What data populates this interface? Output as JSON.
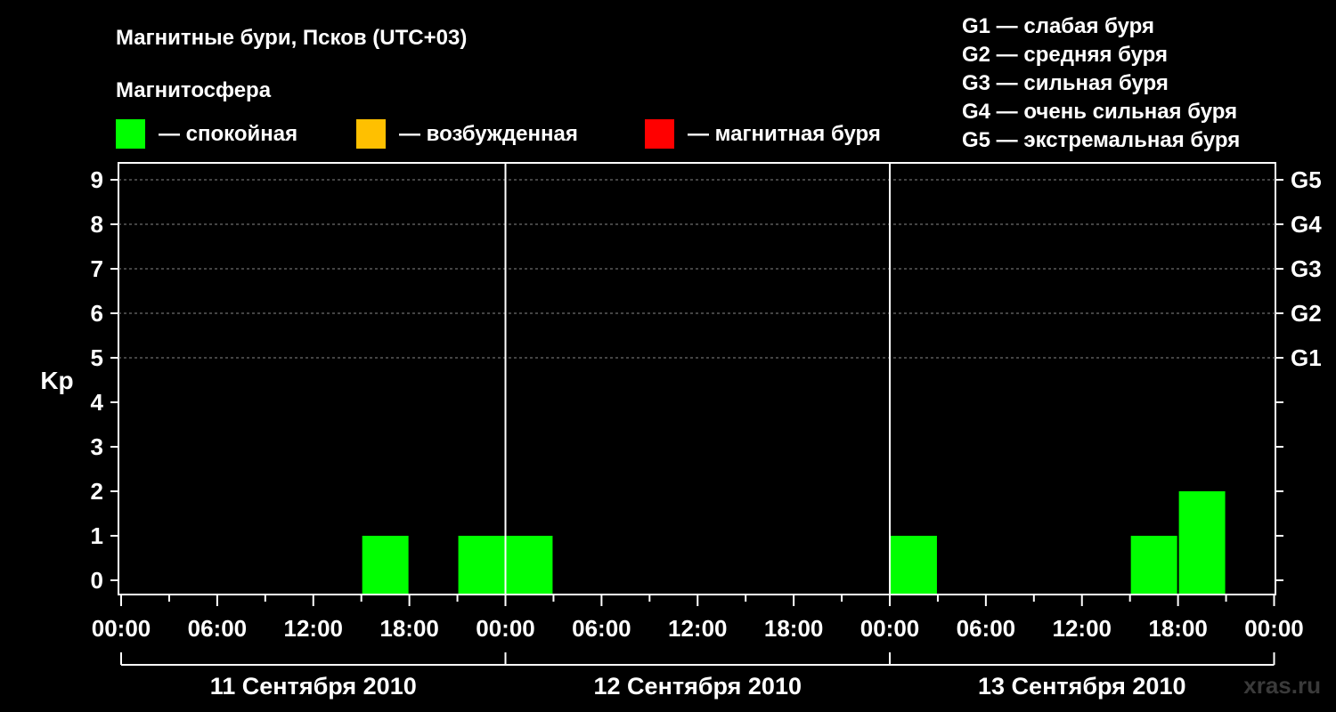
{
  "header": {
    "title": "Магнитные бури, Псков (UTC+03)",
    "subtitle": "Магнитосфера"
  },
  "legend": [
    {
      "label": "— спокойная",
      "color": "#00ff00"
    },
    {
      "label": "— возбужденная",
      "color": "#ffc000"
    },
    {
      "label": "— магнитная буря",
      "color": "#ff0000"
    }
  ],
  "storm_scale": [
    "G1 — слабая буря",
    "G2 — средняя буря",
    "G3 — сильная буря",
    "G4 — очень сильная буря",
    "G5 — экстремальная буря"
  ],
  "watermark": "xras.ru",
  "chart_data": {
    "type": "bar",
    "ylabel": "Kp",
    "ylim": [
      0,
      9
    ],
    "yticks": [
      "0",
      "1",
      "2",
      "3",
      "4",
      "5",
      "6",
      "7",
      "8",
      "9"
    ],
    "right_axis_labels": [
      {
        "kp": 5,
        "label": "G1"
      },
      {
        "kp": 6,
        "label": "G2"
      },
      {
        "kp": 7,
        "label": "G3"
      },
      {
        "kp": 8,
        "label": "G4"
      },
      {
        "kp": 9,
        "label": "G5"
      }
    ],
    "x_tick_labels": [
      "00:00",
      "06:00",
      "12:00",
      "18:00",
      "00:00",
      "06:00",
      "12:00",
      "18:00",
      "00:00",
      "06:00",
      "12:00",
      "18:00",
      "00:00"
    ],
    "dates": [
      "11 Сентября 2010",
      "12 Сентября 2010",
      "13 Сентября 2010"
    ],
    "grid": "dashed horizontal at Kp 5–9",
    "bars": [
      {
        "day": 0,
        "start_hour": 15,
        "kp": 1,
        "color": "#00ff00"
      },
      {
        "day": 0,
        "start_hour": 21,
        "kp": 1,
        "color": "#00ff00"
      },
      {
        "day": 1,
        "start_hour": 0,
        "kp": 1,
        "color": "#00ff00"
      },
      {
        "day": 2,
        "start_hour": 0,
        "kp": 1,
        "color": "#00ff00"
      },
      {
        "day": 2,
        "start_hour": 15,
        "kp": 1,
        "color": "#00ff00"
      },
      {
        "day": 2,
        "start_hour": 18,
        "kp": 2,
        "color": "#00ff00"
      }
    ]
  }
}
